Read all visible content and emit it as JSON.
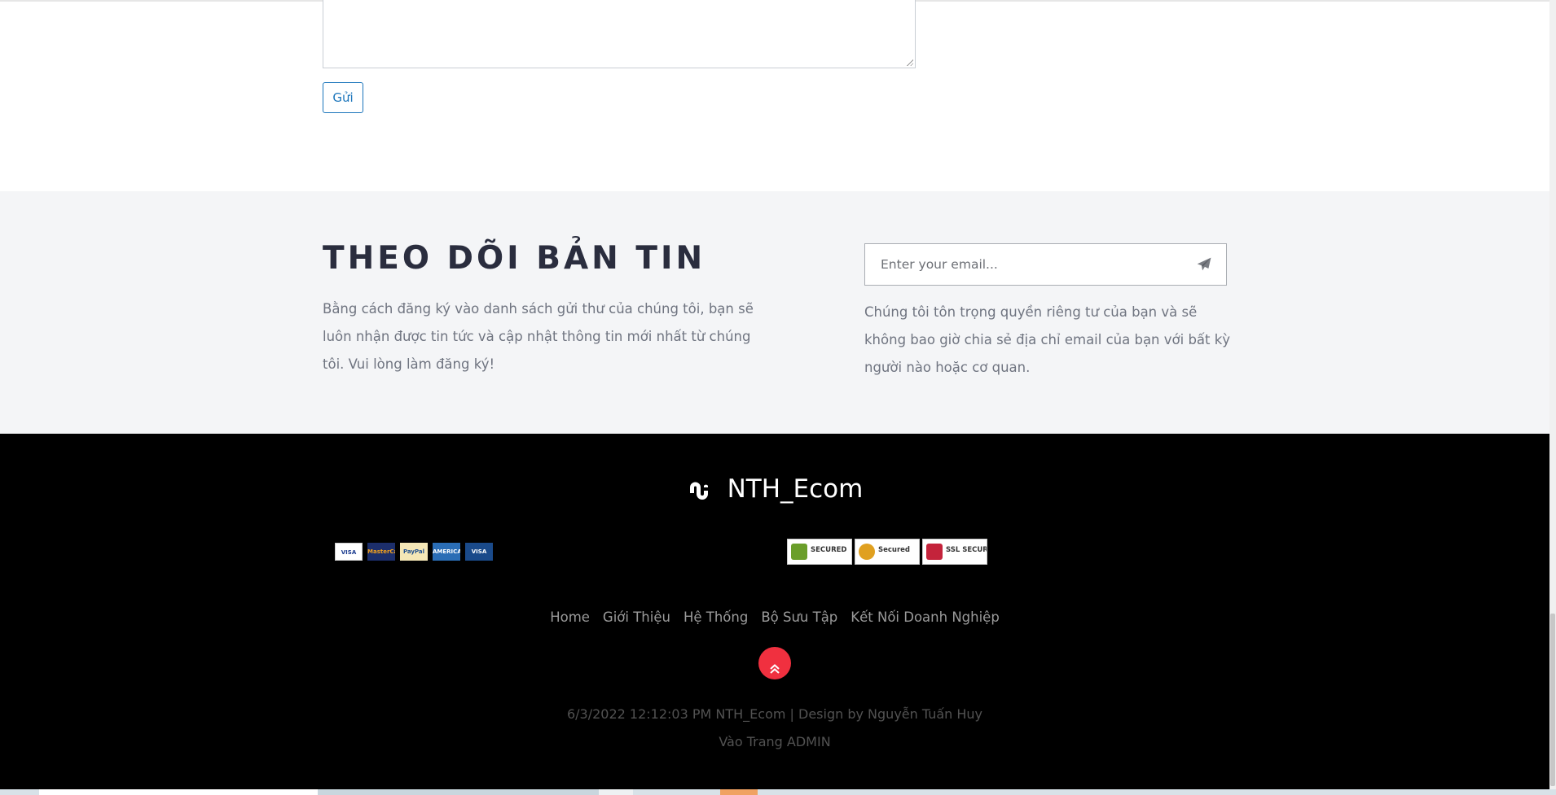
{
  "contact": {
    "submit_label": "Gửi"
  },
  "newsletter": {
    "title": "THEO DÕI BẢN TIN",
    "description": "Bằng cách đăng ký vào danh sách gửi thư của chúng tôi, bạn sẽ luôn nhận được tin tức và cập nhật thông tin mới nhất từ chúng tôi. Vui lòng làm đăng ký!",
    "email_placeholder": "Enter your email...",
    "email_value": "",
    "privacy_note": "Chúng tôi tôn trọng quyền riêng tư của bạn và sẽ không bao giờ chia sẻ địa chỉ email của bạn với bất kỳ người nào hoặc cơ quan."
  },
  "footer": {
    "brand": "NTH_Ecom",
    "payment_cards": [
      {
        "label": "VISA",
        "bg": "#ffffff",
        "fg": "#1a3b8f"
      },
      {
        "label": "MasterCard",
        "bg": "#1c2e6b",
        "fg": "#f4a21c"
      },
      {
        "label": "PayPal",
        "bg": "#f5e7b6",
        "fg": "#1f4f8f"
      },
      {
        "label": "AMERICAN EXPRESS",
        "bg": "#2a6db5",
        "fg": "#ffffff"
      },
      {
        "label": "VISA Electron",
        "bg": "#1a4a8a",
        "fg": "#ffffff"
      }
    ],
    "security_badges": [
      {
        "label": "SECURED",
        "icon": "lock-shield-icon",
        "color": "#6a9e2a"
      },
      {
        "label": "Secured",
        "icon": "check-seal-icon",
        "color": "#e0a020"
      },
      {
        "label": "SSL SECURE",
        "icon": "ssl-shield-icon",
        "color": "#c4233b"
      }
    ],
    "nav": [
      {
        "label": "Home"
      },
      {
        "label": "Giới Thiệu"
      },
      {
        "label": "Hệ Thống"
      },
      {
        "label": "Bộ Sưu Tập"
      },
      {
        "label": "Kết Nối Doanh Nghiệp"
      }
    ],
    "copyright": "6/3/2022 12:12:03 PM NTH_Ecom | Design by Nguyễn Tuấn Huy",
    "admin_link": "Vào Trang ADMIN"
  },
  "colors": {
    "accent_blue": "#1b75bb",
    "newsletter_bg": "#f4f5f7",
    "footer_bg": "#000000",
    "back_to_top": "#f0303f"
  }
}
